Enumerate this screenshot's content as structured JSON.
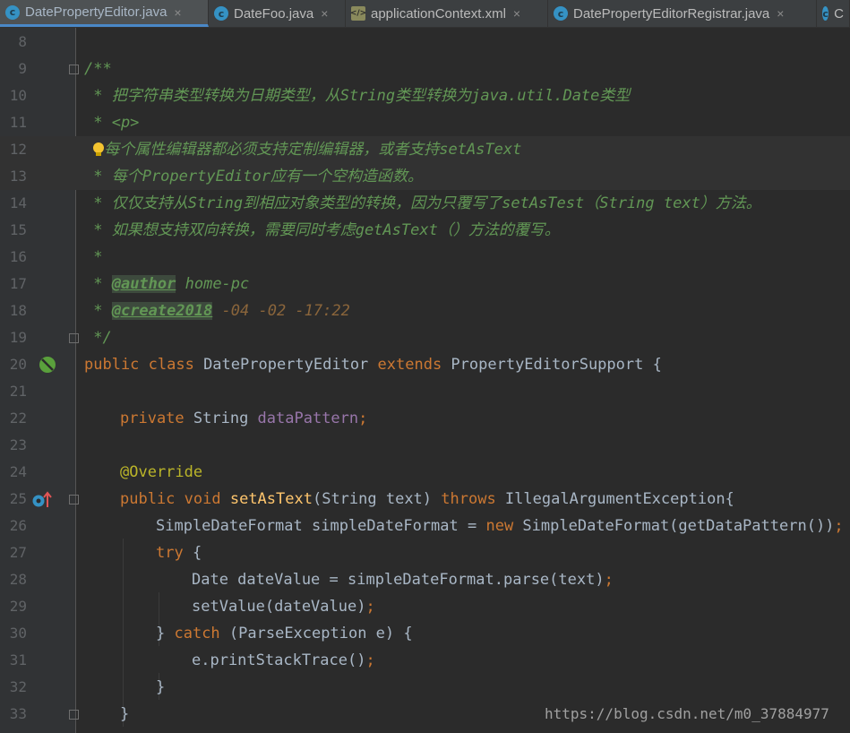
{
  "tabs": [
    {
      "label": "DatePropertyEditor.java",
      "icon": "class-icon",
      "active": true
    },
    {
      "label": "DateFoo.java",
      "icon": "class-icon",
      "active": false
    },
    {
      "label": "applicationContext.xml",
      "icon": "xml-file-icon",
      "active": false
    },
    {
      "label": "DatePropertyEditorRegistrar.java",
      "icon": "class-icon",
      "active": false
    },
    {
      "label": "C",
      "icon": "class-icon",
      "active": false
    }
  ],
  "close_glyph": "×",
  "line_numbers": [
    "8",
    "9",
    "10",
    "11",
    "12",
    "13",
    "14",
    "15",
    "16",
    "17",
    "18",
    "19",
    "20",
    "21",
    "22",
    "23",
    "24",
    "25",
    "26",
    "27",
    "28",
    "29",
    "30",
    "31",
    "32",
    "33"
  ],
  "code": {
    "l9": "/**",
    "l10": " * 把字符串类型转换为日期类型，从String类型转换为java.util.Date类型",
    "l11": " * <p>",
    "l12": " 每个属性编辑器都必须支持定制编辑器，或者支持setAsText",
    "l13": " * 每个PropertyEditor应有一个空构造函数。",
    "l14": " * 仅仅支持从String到相应对象类型的转换，因为只覆写了setAsTest（String text）方法。",
    "l15": " * 如果想支持双向转换，需要同时考虑getAsText（）方法的覆写。",
    "l16": " *",
    "l17_star": " * ",
    "l17_tag": "@author",
    "l17_val": " home-pc",
    "l18_star": " * ",
    "l18_tag": "@create2018",
    "l18_val": " -04 -02 -17:22",
    "l19": " */",
    "l20_kw": "public class",
    "l20_name": " DatePropertyEditor ",
    "l20_ext": "extends",
    "l20_rest": " PropertyEditorSupport {",
    "l22_kw": "private",
    "l22_type": " String ",
    "l22_field": "dataPattern",
    "l22_semi": ";",
    "l24": "@Override",
    "l25_kw": "public void",
    "l25_fn": "setAsText",
    "l25_params": "(String text) ",
    "l25_throws": "throws",
    "l25_rest": " IllegalArgumentException{",
    "l26_a": "SimpleDateFormat simpleDateFormat = ",
    "l26_new": "new",
    "l26_b": " SimpleDateFormat(getDataPattern())",
    "l26_semi": ";",
    "l27_kw": "try",
    "l27_rest": " {",
    "l28_a": "Date dateValue = simpleDateFormat.parse(text)",
    "l28_semi": ";",
    "l29_a": "setValue(dateValue)",
    "l29_semi": ";",
    "l30_a": "} ",
    "l30_kw": "catch",
    "l30_rest": " (ParseException e) {",
    "l31_a": "e.printStackTrace()",
    "l31_semi": ";",
    "l32": "}",
    "l33": "}"
  },
  "watermark": "https://blog.csdn.net/m0_37884977"
}
